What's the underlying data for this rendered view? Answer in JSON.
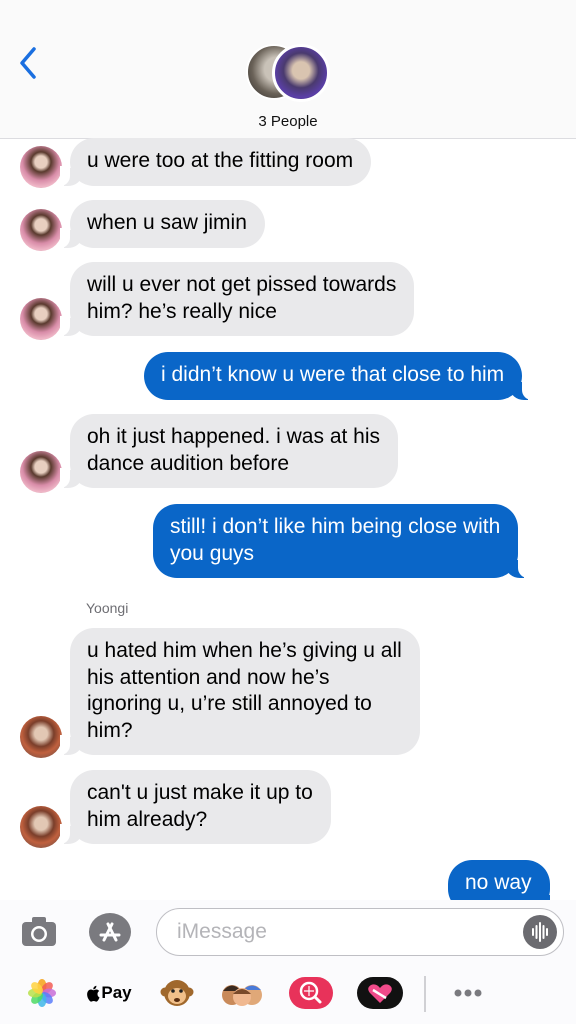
{
  "header": {
    "group_name": "3 People"
  },
  "messages": [
    {
      "id": "m1",
      "direction": "incoming",
      "text": "u were too at the fitting room"
    },
    {
      "id": "m2",
      "direction": "incoming",
      "text": "when u saw jimin"
    },
    {
      "id": "m3",
      "direction": "incoming",
      "text": "will u ever not get pissed towards\nhim? he’s really nice"
    },
    {
      "id": "m4",
      "direction": "outgoing",
      "text": "i didn’t know u were that close to him"
    },
    {
      "id": "m5",
      "direction": "incoming",
      "text": "oh it just happened. i was at his\ndance audition before"
    },
    {
      "id": "m6",
      "direction": "outgoing",
      "text": "still! i don’t like him being close with\nyou guys"
    },
    {
      "id": "m7",
      "direction": "incoming",
      "sender": "Yoongi",
      "text": "u hated him when he’s giving u all\nhis attention and now he’s\nignoring u, u’re still annoyed to\nhim?"
    },
    {
      "id": "m8",
      "direction": "incoming",
      "text": "can't u just make it up to\nhim already?"
    },
    {
      "id": "m9",
      "direction": "outgoing",
      "text": "no way"
    }
  ],
  "sender_label": "Yoongi",
  "composer": {
    "placeholder": "iMessage"
  },
  "app_drawer": {
    "apple_pay_label": "Pay",
    "items": [
      "photos-icon",
      "apple-pay-icon",
      "monkey-sticker-icon",
      "memoji-icon",
      "search-images-icon",
      "heart-stickers-icon",
      "more-icon"
    ]
  },
  "colors": {
    "outgoing_bubble": "#0a66c8",
    "incoming_bubble": "#e9e9eb",
    "accent": "#1a6fe0",
    "battery": "#34c759"
  }
}
